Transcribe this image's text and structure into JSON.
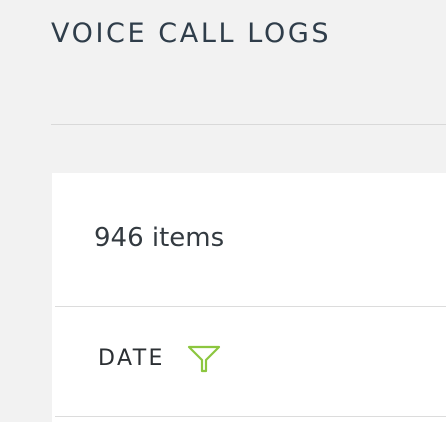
{
  "page": {
    "title": "VOICE CALL LOGS"
  },
  "list": {
    "item_count": "946 items",
    "columns": [
      {
        "label": "DATE",
        "icon": "filter-icon"
      }
    ]
  },
  "colors": {
    "accent": "#8cc63f",
    "background": "#f2f2f2",
    "panel": "#ffffff"
  }
}
